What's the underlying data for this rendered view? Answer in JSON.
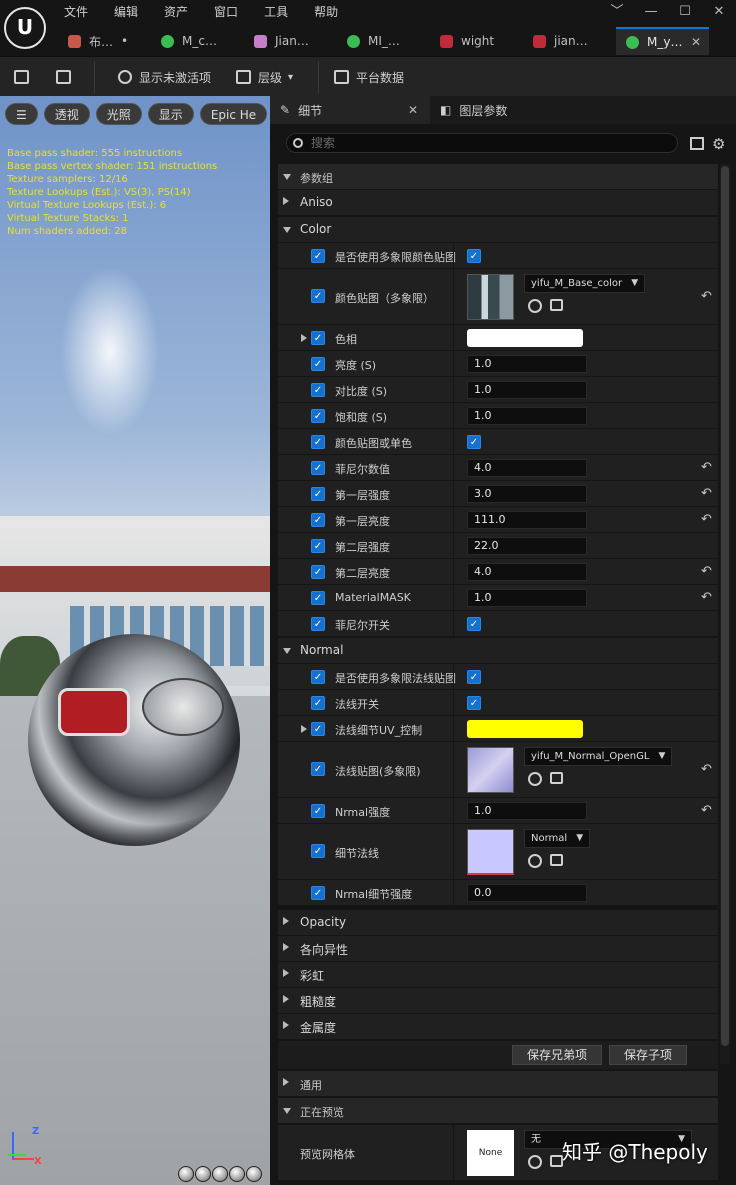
{
  "app": {
    "logo": "U"
  },
  "menus": [
    "文件",
    "编辑",
    "资产",
    "窗口",
    "工具",
    "帮助"
  ],
  "window_controls": [
    "﹀",
    "—",
    "☐",
    "✕"
  ],
  "tabs": [
    {
      "label": "布…",
      "color": "#c8584a",
      "modified": "•"
    },
    {
      "label": "M_c…",
      "color": "#3cbd54"
    },
    {
      "label": "Jian…",
      "color": "#c77ec8"
    },
    {
      "label": "MI_…",
      "color": "#3cbd54"
    },
    {
      "label": "wight",
      "color": "#c22a3a"
    },
    {
      "label": "jian…",
      "color": "#c22a3a"
    },
    {
      "label": "M_y…",
      "color": "#3cbd54",
      "active": true,
      "close": "✕"
    }
  ],
  "toolbar": {
    "show_inactive": "显示未激活项",
    "hierarchy": "层级",
    "platform_stats": "平台数据"
  },
  "viewport": {
    "buttons": [
      "☰",
      "透视",
      "光照",
      "显示",
      "Epic He"
    ],
    "stats": [
      "Base pass shader: 555 instructions",
      "Base pass vertex shader: 151 instructions",
      "Texture samplers: 12/16",
      "Texture Lookups (Est.): VS(3), PS(14)",
      "Virtual Texture Lookups (Est.): 6",
      "Virtual Texture Stacks: 1",
      "Num shaders added: 28"
    ],
    "axis": {
      "z": "Z",
      "x": "X"
    }
  },
  "panel": {
    "tab_details": "细节",
    "tab_layers": "图层参数",
    "search_placeholder": "搜索",
    "param_group": "参数组",
    "aniso": "Aniso",
    "color_group": {
      "label": "Color",
      "rows": [
        {
          "name": "是否使用多象限颜色贴图",
          "type": "check"
        },
        {
          "name": "颜色贴图（多象限）",
          "type": "texture",
          "texture": "yifu_M_Base_color"
        },
        {
          "name": "色相",
          "type": "color",
          "color": "#ffffff"
        },
        {
          "name": "亮度 (S)",
          "type": "number",
          "value": "1.0"
        },
        {
          "name": "对比度 (S)",
          "type": "number",
          "value": "1.0"
        },
        {
          "name": "饱和度 (S)",
          "type": "number",
          "value": "1.0"
        },
        {
          "name": "颜色贴图或单色",
          "type": "check"
        },
        {
          "name": "菲尼尔数值",
          "type": "number",
          "value": "4.0",
          "reset": true
        },
        {
          "name": "第一层强度",
          "type": "number",
          "value": "3.0",
          "reset": true
        },
        {
          "name": "第一层亮度",
          "type": "number",
          "value": "111.0",
          "reset": true
        },
        {
          "name": "第二层强度",
          "type": "number",
          "value": "22.0"
        },
        {
          "name": "第二层亮度",
          "type": "number",
          "value": "4.0",
          "reset": true
        },
        {
          "name": "MaterialMASK",
          "type": "number",
          "value": "1.0",
          "reset": true
        },
        {
          "name": "菲尼尔开关",
          "type": "check"
        }
      ]
    },
    "normal_group": {
      "label": "Normal",
      "rows": [
        {
          "name": "是否使用多象限法线贴图",
          "type": "check"
        },
        {
          "name": "法线开关",
          "type": "check"
        },
        {
          "name": "法线细节UV_控制",
          "type": "color",
          "color": "#ffff00"
        },
        {
          "name": "法线贴图(多象限)",
          "type": "texture",
          "texture": "yifu_M_Normal_OpenGL"
        },
        {
          "name": "Nrmal强度",
          "type": "number",
          "value": "1.0",
          "reset": true
        },
        {
          "name": "细节法线",
          "type": "texture",
          "texture": "Normal"
        },
        {
          "name": "Nrmal细节强度",
          "type": "number",
          "value": "0.0"
        }
      ]
    },
    "collapsed": [
      "Opacity",
      "各向异性",
      "彩虹",
      "粗糙度",
      "金属度"
    ],
    "save_sibling": "保存兄弟项",
    "save_child": "保存子项",
    "general": "通用",
    "previewing": "正在预览",
    "preview_mesh_label": "预览网格体",
    "preview_mesh_value": "无",
    "preview_thumb": "None"
  },
  "watermark": "知乎 @Thepoly",
  "colors": {
    "accent": "#0a78d6",
    "check": "#1570d0",
    "stats": "#e8e02a"
  }
}
